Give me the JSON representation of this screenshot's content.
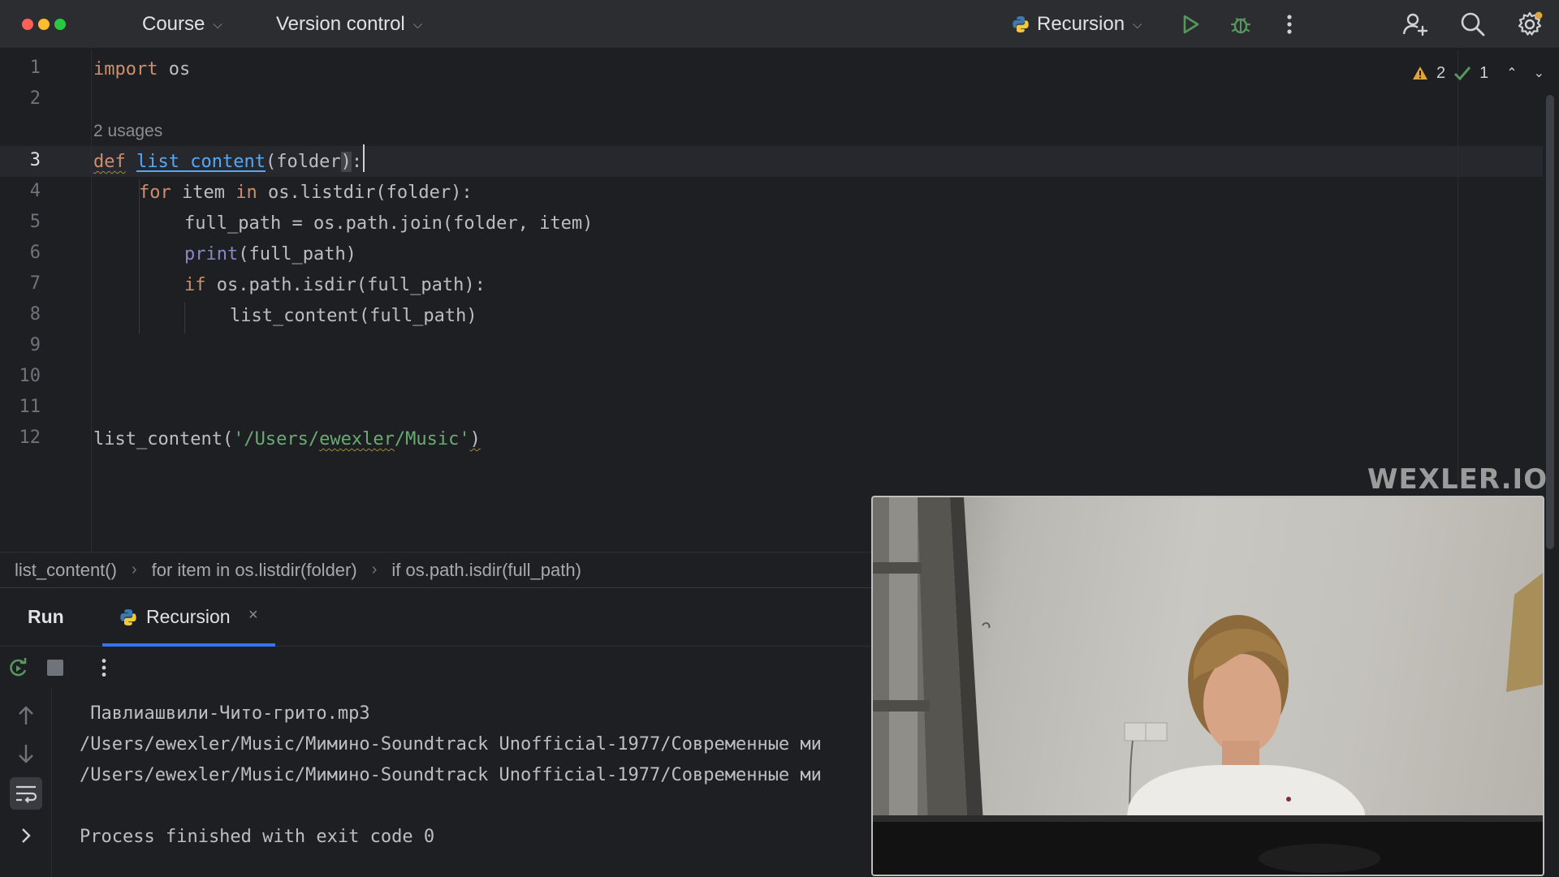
{
  "toolbar": {
    "traffic_colors": [
      "#fe5f57",
      "#febc2e",
      "#28c840"
    ],
    "menu_course": "Course",
    "menu_version_control": "Version control",
    "run_config": "Recursion",
    "accent_run": "#57965c",
    "icons": [
      "chevron-down-icon",
      "python-icon",
      "run-icon",
      "debug-icon",
      "more-vertical-icon",
      "add-user-icon",
      "search-icon",
      "settings-icon"
    ]
  },
  "editor": {
    "line_numbers": [
      "1",
      "2",
      "3",
      "4",
      "5",
      "6",
      "7",
      "8",
      "9",
      "10",
      "11",
      "12"
    ],
    "current_line": "3",
    "usages_hint": "2 usages",
    "inspection": {
      "warnings": "2",
      "ok": "1"
    },
    "lines": {
      "l1_kw": "import",
      "l1_rest": " os",
      "l3_kw": "def",
      "l3_fn": "list_content",
      "l3_rest_a": "(folder",
      "l3_rest_b": ")",
      "l3_rest_c": ":",
      "l4_kw1": "for",
      "l4_mid": " item ",
      "l4_kw2": "in",
      "l4_rest": " os.listdir(folder):",
      "l5": "full_path = os.path.join(folder, item)",
      "l6_bi": "print",
      "l6_rest": "(full_path)",
      "l7_kw": "if",
      "l7_rest": " os.path.isdir(full_path):",
      "l8": "list_content(full_path)",
      "l12_a": "list_content(",
      "l12_str_a": "'/Users/",
      "l12_str_b": "ewexler",
      "l12_str_c": "/Music'",
      "l12_b": ")"
    },
    "watermark": "WEXLER.IO"
  },
  "breadcrumb": [
    "list_content()",
    "for item in os.listdir(folder)",
    "if os.path.isdir(full_path)"
  ],
  "run_panel": {
    "title": "Run",
    "tab_label": "Recursion",
    "tab_close": "×",
    "output": [
      " Павлиашвили-Чито-грито.mp3",
      "/Users/ewexler/Music/Мимино-Soundtrack Unofficial-1977/Современные ми",
      "/Users/ewexler/Music/Мимино-Soundtrack Unofficial-1977/Современные ми",
      "",
      "Process finished with exit code 0"
    ]
  }
}
